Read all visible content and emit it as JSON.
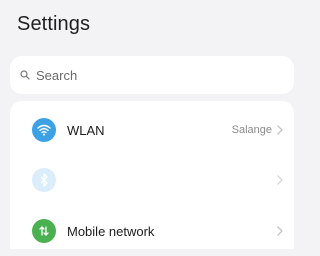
{
  "header": {
    "title": "Settings"
  },
  "search": {
    "placeholder": "Search"
  },
  "settings_list": {
    "items": [
      {
        "label": "WLAN",
        "value": "Salange",
        "icon": "wifi-icon",
        "icon_color": "#3da1e6"
      },
      {
        "label": "",
        "value": "",
        "icon": "bluetooth-icon",
        "icon_color": "#3da1e6",
        "faded": true
      },
      {
        "label": "Mobile network",
        "value": "",
        "icon": "mobile-network-icon",
        "icon_color": "#4bb04f"
      }
    ]
  }
}
